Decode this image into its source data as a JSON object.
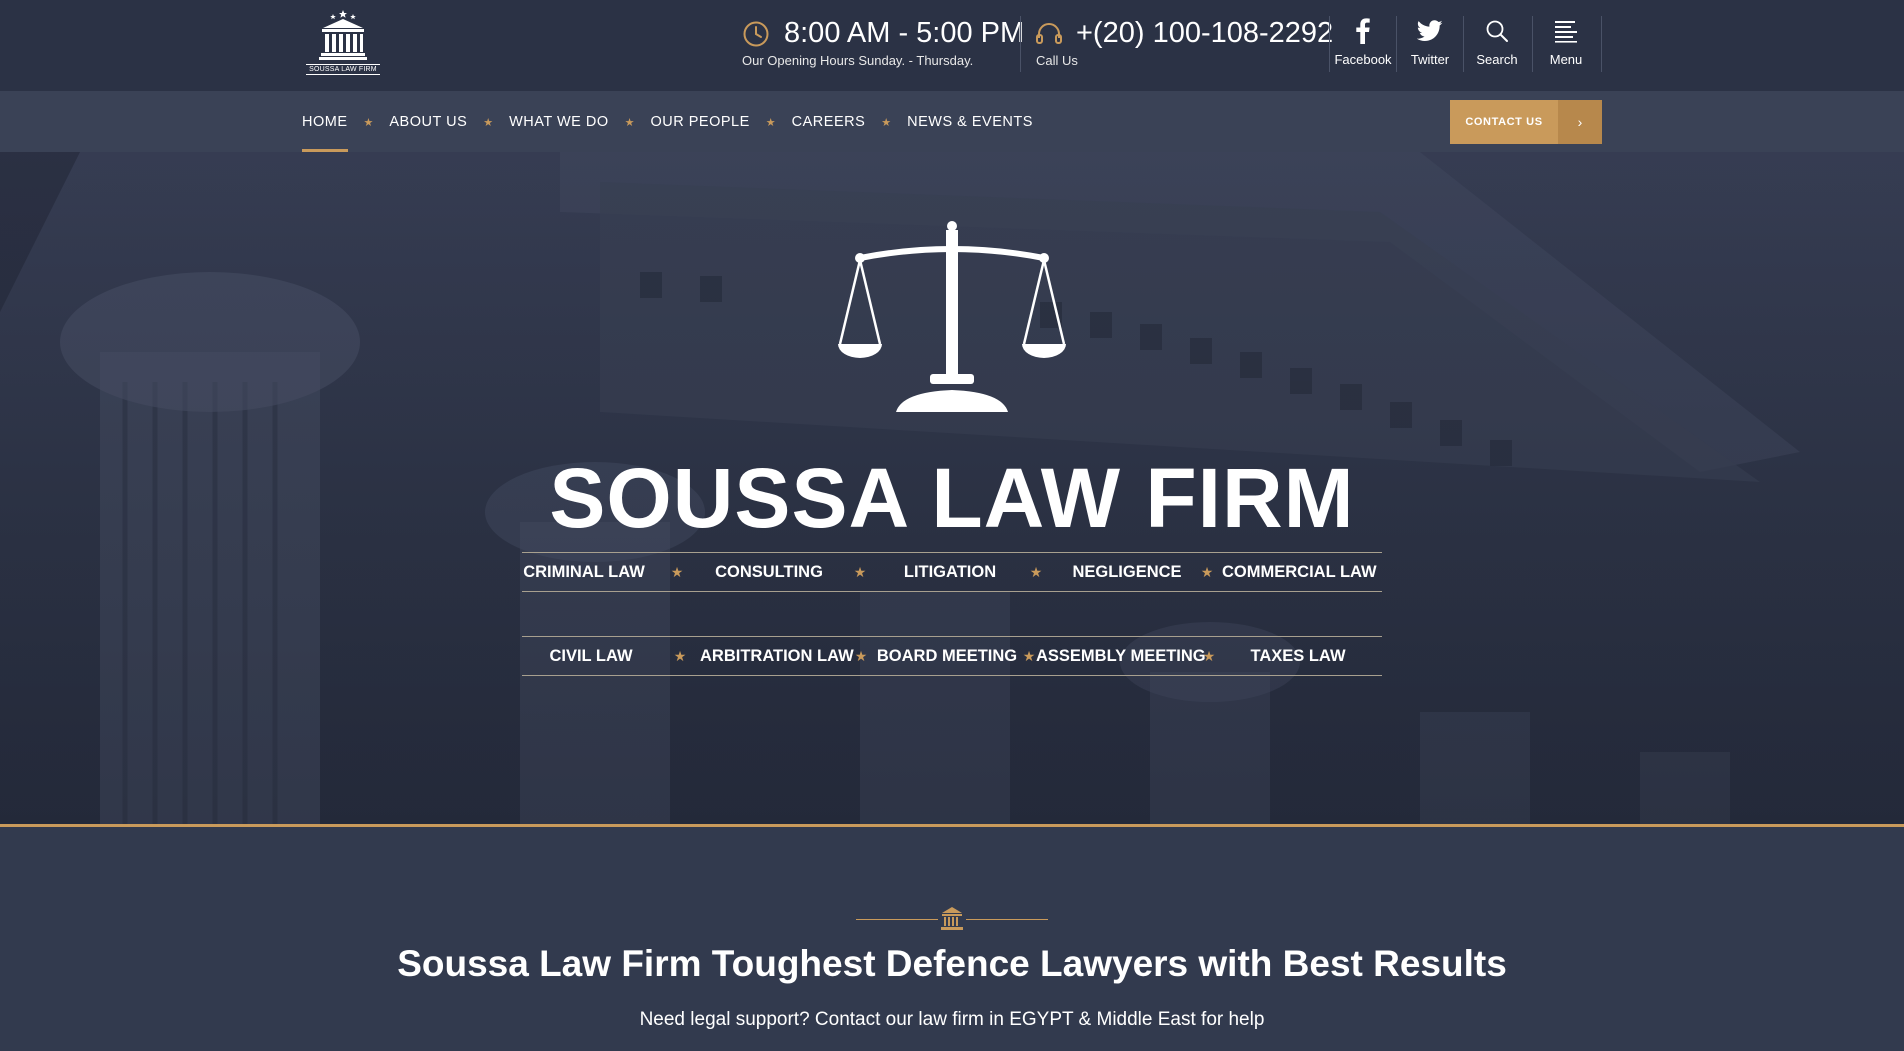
{
  "brand": {
    "logo_text": "SOUSSA LAW FIRM"
  },
  "header": {
    "hours": {
      "time": "8:00 AM - 5:00 PM",
      "subtitle": "Our Opening Hours Sunday. - Thursday."
    },
    "call": {
      "phone": "+(20) 100-108-2292",
      "subtitle": "Call Us"
    },
    "tools": [
      {
        "label": "Facebook",
        "icon": "facebook-icon"
      },
      {
        "label": "Twitter",
        "icon": "twitter-icon"
      },
      {
        "label": "Search",
        "icon": "search-icon"
      },
      {
        "label": "Menu",
        "icon": "menu-icon"
      }
    ]
  },
  "nav": {
    "items": [
      "HOME",
      "ABOUT US",
      "WHAT WE DO",
      "OUR PEOPLE",
      "CAREERS",
      "NEWS & EVENTS"
    ],
    "active": "HOME",
    "contact_label": "CONTACT US"
  },
  "hero": {
    "title": "SOUSSA LAW FIRM",
    "services_row1": [
      "CRIMINAL LAW",
      "CONSULTING",
      "LITIGATION",
      "NEGLIGENCE",
      "COMMERCIAL LAW"
    ],
    "services_row2": [
      "CIVIL LAW",
      "ARBITRATION LAW",
      "BOARD MEETING",
      "ASSEMBLY MEETING",
      "TAXES LAW"
    ]
  },
  "intro": {
    "heading": "Soussa Law Firm Toughest Defence Lawyers with Best Results",
    "text": "Need legal support? Contact our law firm in EGYPT & Middle East for help"
  },
  "colors": {
    "accent": "#c99a5b",
    "header_bg": "#2b3245",
    "nav_bg": "#3a4256"
  }
}
